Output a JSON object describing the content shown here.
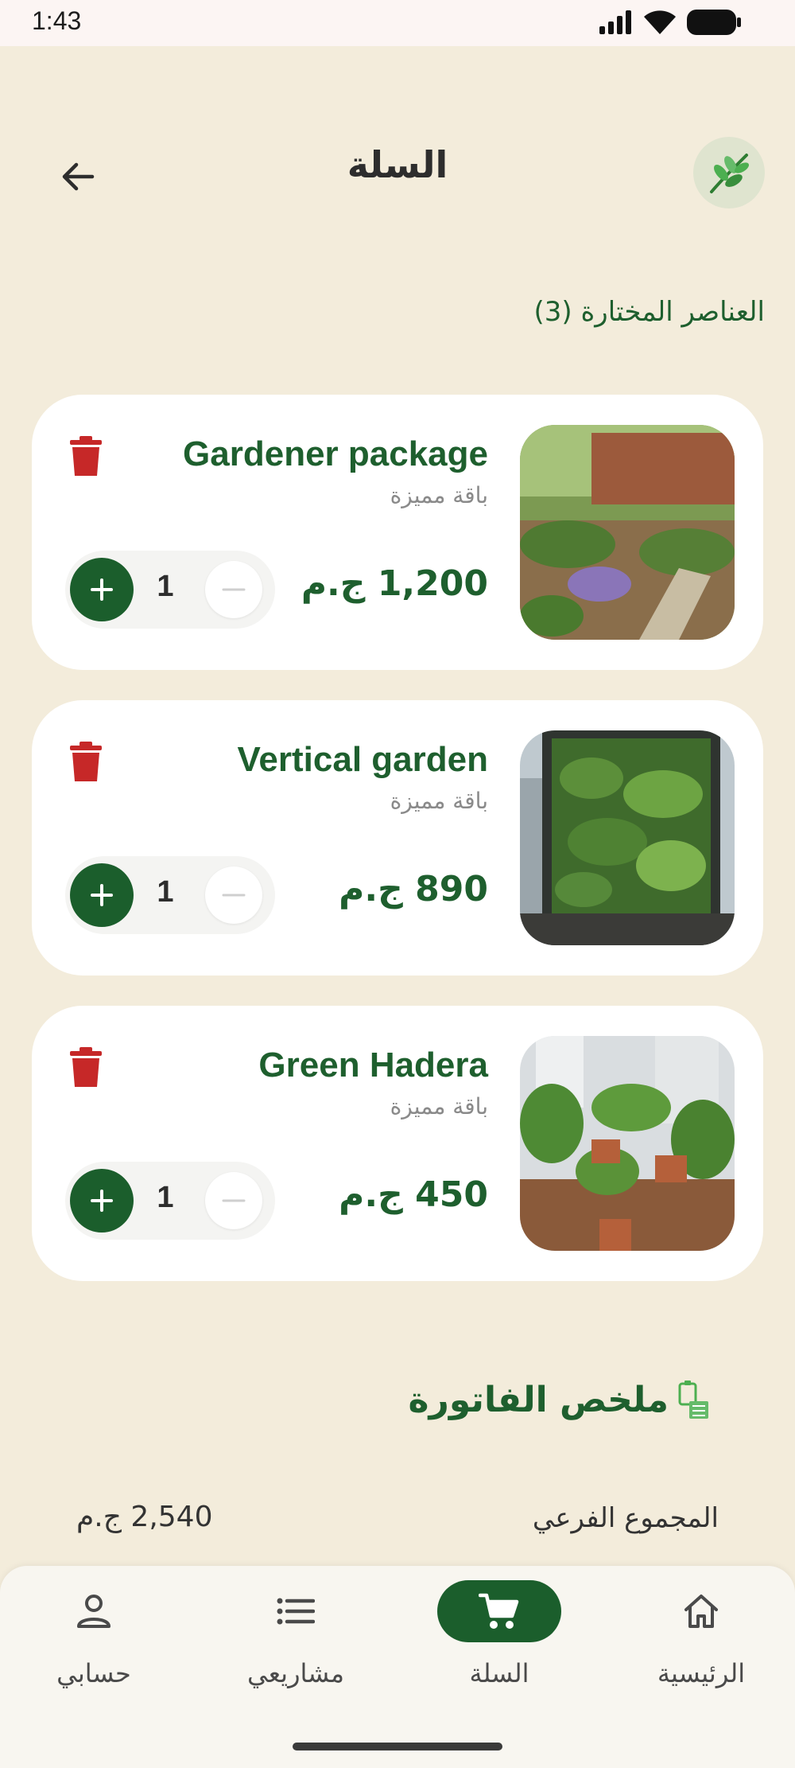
{
  "status": {
    "time": "1:43"
  },
  "header": {
    "title": "السلة"
  },
  "cart": {
    "selected_label": "العناصر المختارة (3)",
    "items": [
      {
        "title": "Gardener package",
        "subtitle": "باقة مميزة",
        "price": "1,200 ج.م",
        "qty": "1"
      },
      {
        "title": "Vertical garden",
        "subtitle": "باقة مميزة",
        "price": "890 ج.م",
        "qty": "1"
      },
      {
        "title": "Green Hadera",
        "subtitle": "باقة مميزة",
        "price": "450 ج.م",
        "qty": "1"
      }
    ]
  },
  "summary": {
    "title": "ملخص الفاتورة",
    "subtotal_label": "المجموع الفرعي",
    "subtotal_value": "2,540 ج.م"
  },
  "nav": {
    "items": [
      {
        "label": "الرئيسية",
        "icon": "home-icon"
      },
      {
        "label": "السلة",
        "icon": "cart-icon",
        "active": true
      },
      {
        "label": "مشاريعي",
        "icon": "list-icon"
      },
      {
        "label": "حسابي",
        "icon": "person-icon"
      }
    ]
  },
  "colors": {
    "accent": "#1b5e2c",
    "background": "#f3ecdb",
    "delete": "#c62828"
  }
}
